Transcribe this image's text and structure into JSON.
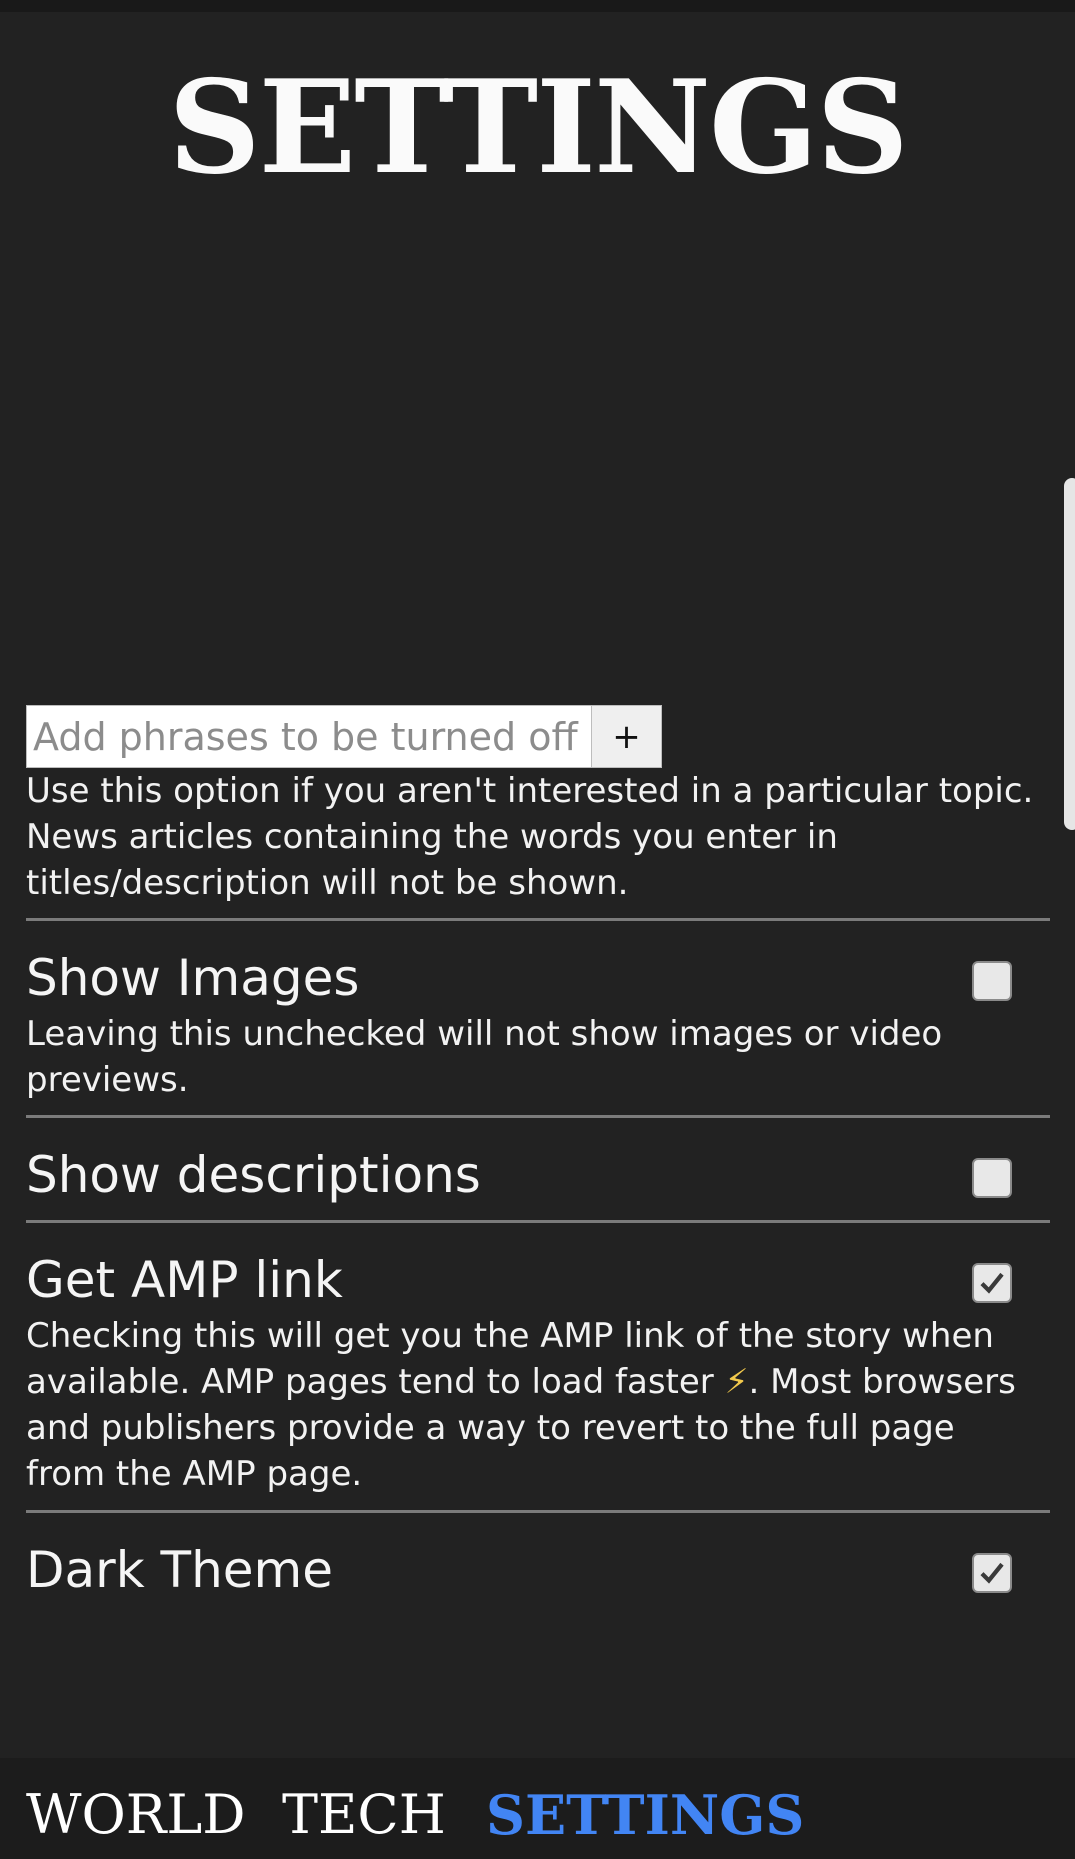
{
  "header": {
    "title": "SETTINGS"
  },
  "filter": {
    "input_placeholder": "Add phrases to be turned off",
    "input_value": "",
    "add_label": "+",
    "help": "Use this option if you aren't interested in a particular topic. News articles containing the words you enter in titles/description will not be shown."
  },
  "settings": [
    {
      "label": "Show Images",
      "checked": false,
      "description": "Leaving this unchecked will not show images or video previews."
    },
    {
      "label": "Show descriptions",
      "checked": false
    },
    {
      "label": "Get AMP link",
      "checked": true,
      "description_before": "Checking this will get you the AMP link of the story when available. AMP pages tend to load faster ",
      "description_icon": "⚡",
      "description_after": ". Most browsers and publishers provide a way to revert to the full page from the AMP page."
    },
    {
      "label": "Dark Theme",
      "checked": true
    }
  ],
  "nav": {
    "items": [
      {
        "label": "WORLD",
        "active": false
      },
      {
        "label": "TECH",
        "active": false
      },
      {
        "label": "SETTINGS",
        "active": true
      }
    ]
  },
  "colors": {
    "background": "#222222",
    "nav_active": "#4285f4",
    "divider": "#7b7b7b"
  },
  "icons": {
    "checkmark": "checkmark-icon",
    "lightning": "lightning-icon"
  }
}
